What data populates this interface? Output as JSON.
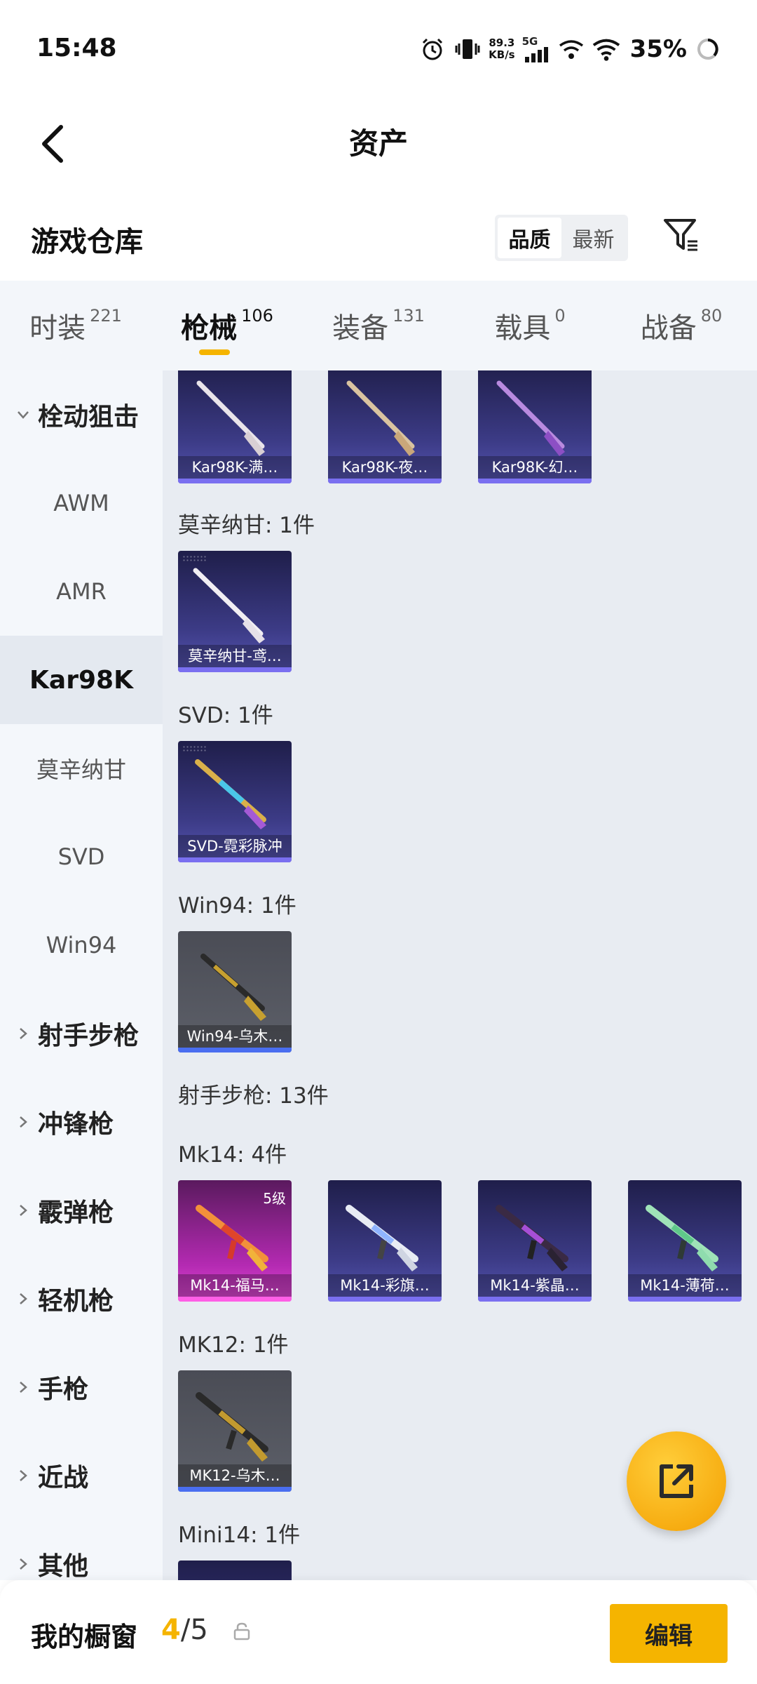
{
  "status_bar": {
    "time": "15:48",
    "net_speed_value": "89.3",
    "net_speed_unit": "KB/s",
    "network_type": "5G",
    "battery": "35%"
  },
  "header": {
    "title": "资产"
  },
  "warehouse": {
    "title": "游戏仓库",
    "sort_options": [
      "品质",
      "最新"
    ],
    "active_sort": "品质"
  },
  "category_tabs": [
    {
      "label": "时装",
      "count": "221"
    },
    {
      "label": "枪械",
      "count": "106",
      "active": true
    },
    {
      "label": "装备",
      "count": "131"
    },
    {
      "label": "载具",
      "count": "0"
    },
    {
      "label": "战备",
      "count": "80"
    }
  ],
  "sidenav": {
    "items": [
      {
        "label": "栓动狙击",
        "type": "group",
        "expanded": true
      },
      {
        "label": "AWM",
        "type": "sub"
      },
      {
        "label": "AMR",
        "type": "sub"
      },
      {
        "label": "Kar98K",
        "type": "sub",
        "active": true
      },
      {
        "label": "莫辛纳甘",
        "type": "sub"
      },
      {
        "label": "SVD",
        "type": "sub"
      },
      {
        "label": "Win94",
        "type": "sub"
      },
      {
        "label": "射手步枪",
        "type": "group"
      },
      {
        "label": "冲锋枪",
        "type": "group"
      },
      {
        "label": "霰弹枪",
        "type": "group"
      },
      {
        "label": "轻机枪",
        "type": "group"
      },
      {
        "label": "手枪",
        "type": "group"
      },
      {
        "label": "近战",
        "type": "group"
      },
      {
        "label": "其他",
        "type": "group"
      }
    ]
  },
  "content": {
    "kar98k_items": [
      "Kar98K-满…",
      "Kar98K-夜…",
      "Kar98K-幻…"
    ],
    "mosin_label": "莫辛纳甘: 1件",
    "mosin_items": [
      "莫辛纳甘-鸢…"
    ],
    "svd_label": "SVD: 1件",
    "svd_items": [
      "SVD-霓彩脉冲"
    ],
    "win94_label": "Win94: 1件",
    "win94_items": [
      "Win94-乌木…"
    ],
    "dmr_label": "射手步枪: 13件",
    "mk14_label": "Mk14: 4件",
    "mk14_items": [
      "Mk14-福马…",
      "Mk14-彩旗…",
      "Mk14-紫晶…",
      "Mk14-薄荷…"
    ],
    "mk14_level": "5级",
    "mk12_label": "MK12: 1件",
    "mk12_items": [
      "MK12-乌木…"
    ],
    "mini14_label": "Mini14: 1件"
  },
  "bottom_bar": {
    "label": "我的橱窗",
    "current": "4",
    "separator": "/",
    "total": "5",
    "edit_label": "编辑"
  },
  "colors": {
    "accent": "#f5b400",
    "card_purple": "#3c3b86",
    "card_pink": "#b42ab2",
    "card_gray": "#5d6069"
  },
  "icons": [
    "alarm-icon",
    "vibrate-icon",
    "signal-icon",
    "wifi-icon",
    "battery-icon",
    "back-arrow-icon",
    "filter-icon",
    "chevron-down-icon",
    "chevron-right-icon",
    "share-icon",
    "lock-icon"
  ]
}
